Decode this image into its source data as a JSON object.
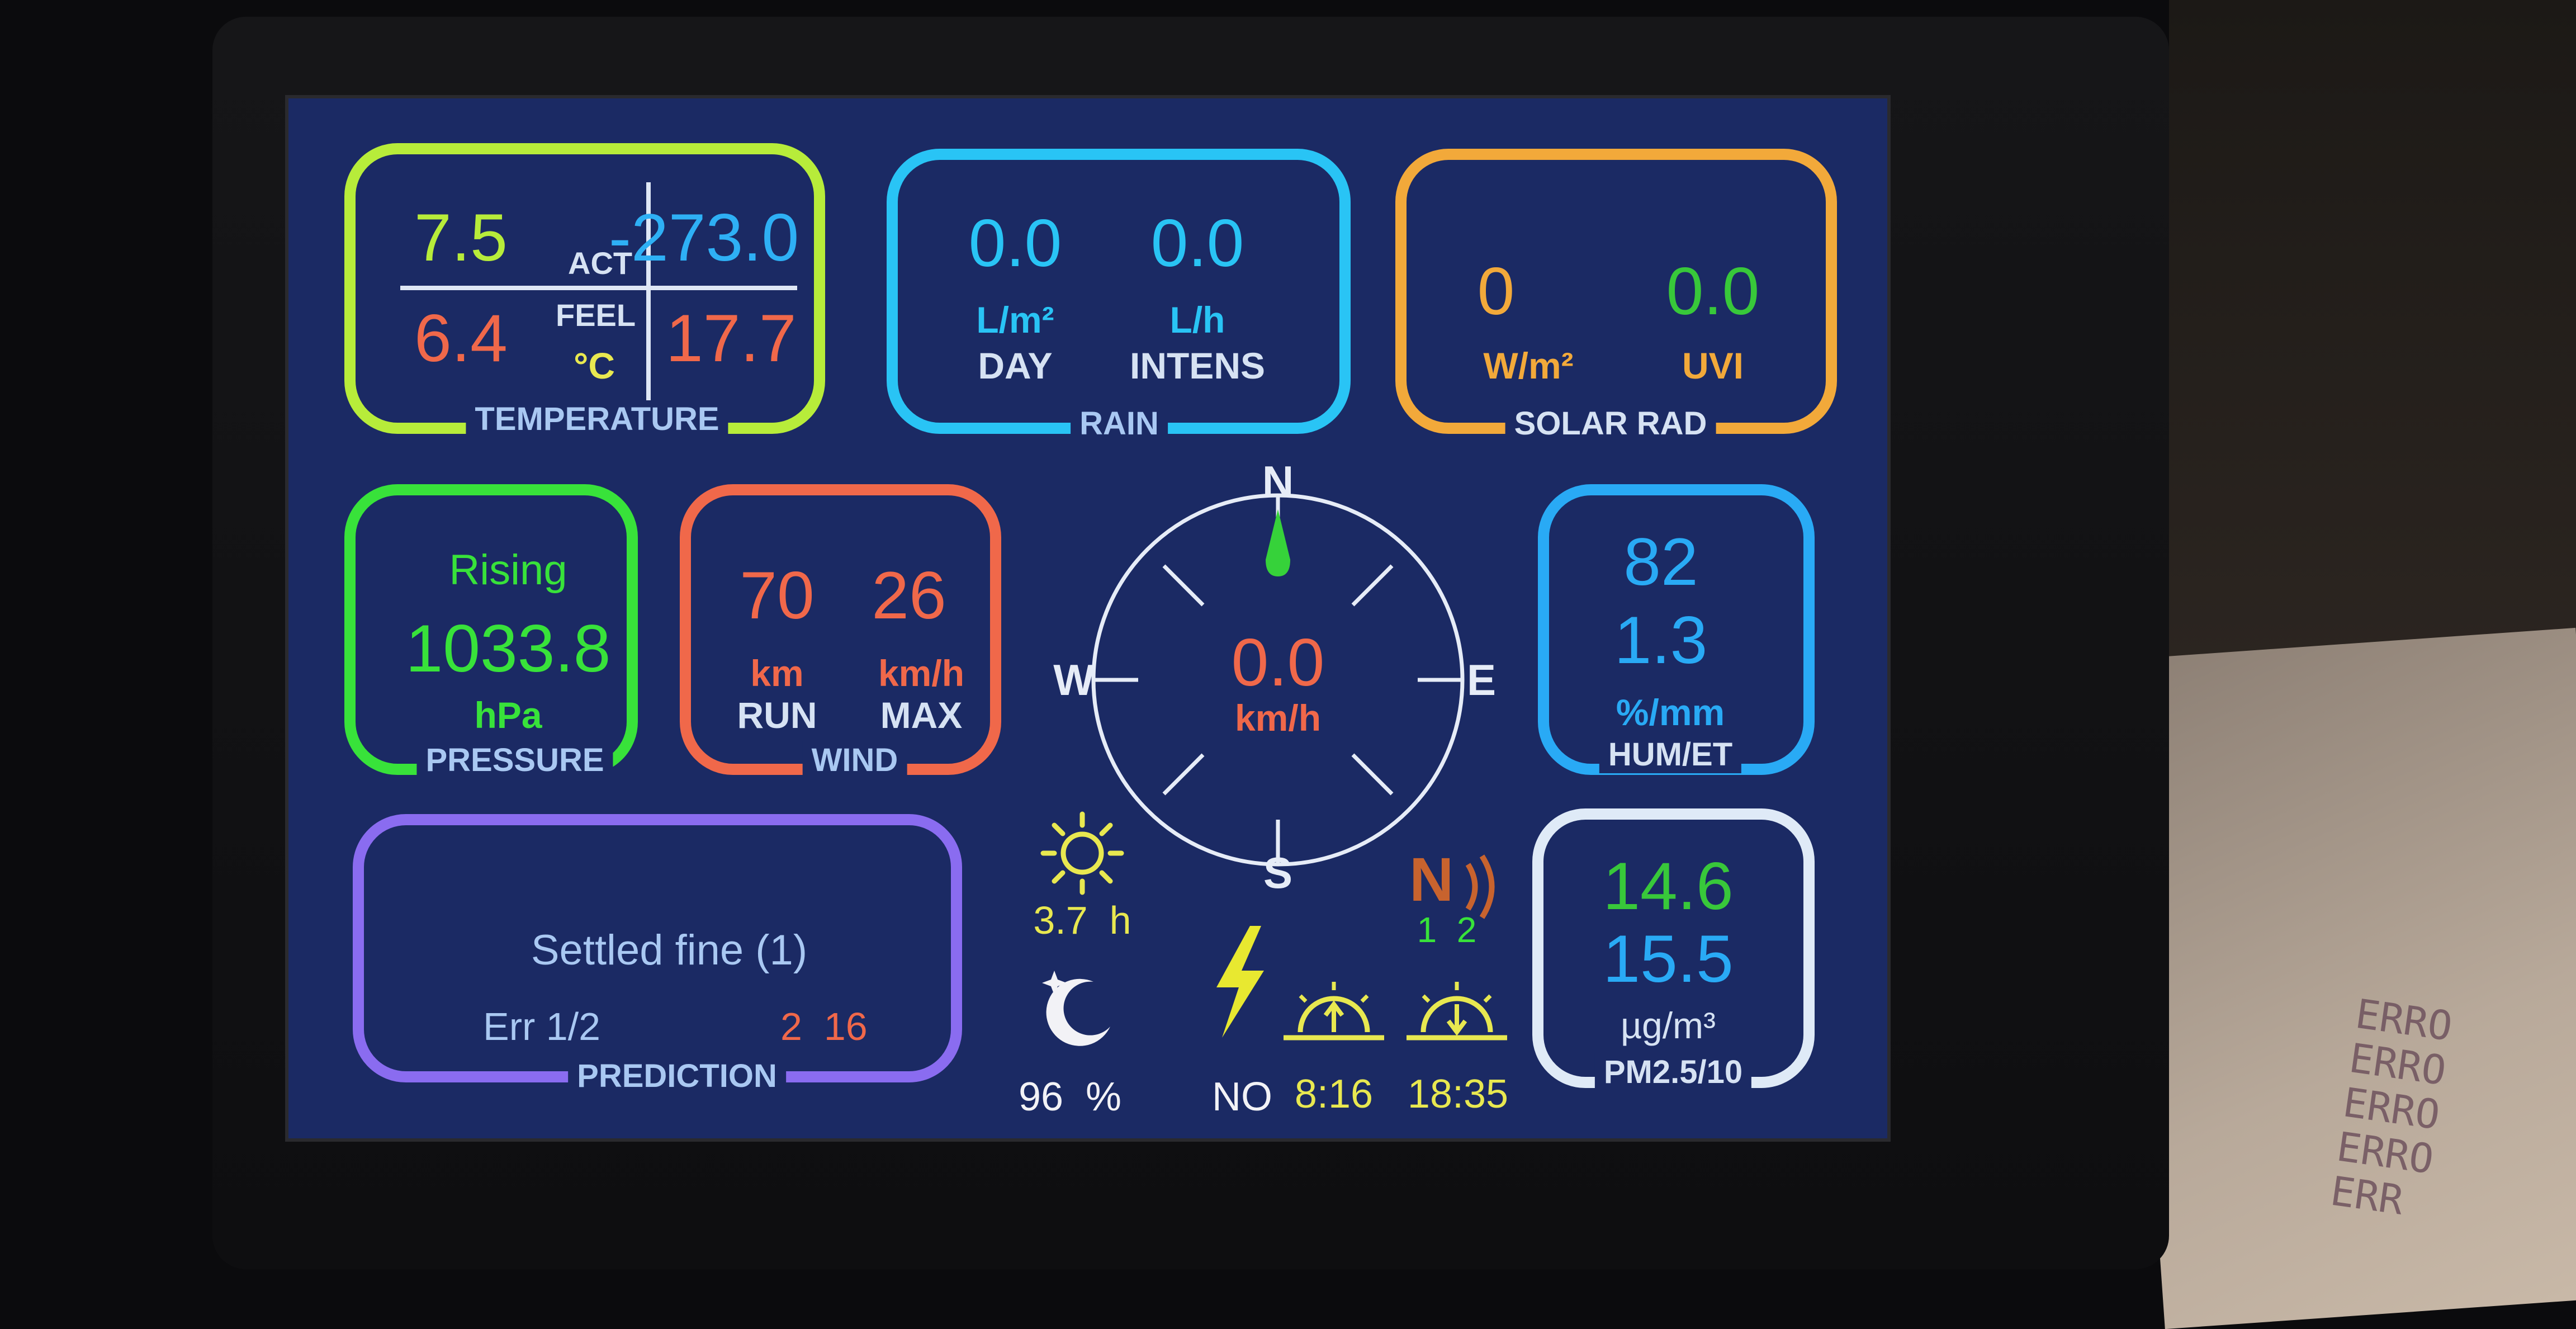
{
  "colors": {
    "screen_bg": "#1b2a64",
    "temperature": "#b7ec3a",
    "rain": "#29c4f5",
    "solar": "#f2a93a",
    "pressure": "#38e23a",
    "wind": "#f0684a",
    "humidity": "#29aaf5",
    "pm": "#dfeaf7",
    "prediction": "#8a6cf0"
  },
  "temperature": {
    "title": "TEMPERATURE",
    "actual": "7.5",
    "feel": "6.4",
    "min": "-273.0",
    "max": "17.7",
    "act_label": "ACT",
    "feel_label": "FEEL",
    "unit": "°C"
  },
  "rain": {
    "title": "RAIN",
    "day_value": "0.0",
    "day_unit": "L/m²",
    "day_label": "DAY",
    "intens_value": "0.0",
    "intens_unit": "L/h",
    "intens_label": "INTENS"
  },
  "solar": {
    "title": "SOLAR RAD",
    "rad_value": "0",
    "rad_unit": "W/m²",
    "uvi_value": "0.0",
    "uvi_label": "UVI"
  },
  "pressure": {
    "title": "PRESSURE",
    "trend": "Rising",
    "value": "1033.8",
    "unit": "hPa"
  },
  "wind": {
    "title": "WIND",
    "run_value": "70",
    "run_unit": "km",
    "run_label": "RUN",
    "max_value": "26",
    "max_unit": "km/h",
    "max_label": "MAX"
  },
  "compass": {
    "n": "N",
    "e": "E",
    "s": "S",
    "w": "W",
    "speed": "0.0",
    "unit": "km/h",
    "direction_deg": 0,
    "needle_icon": "wind-direction-needle"
  },
  "humidity": {
    "title": "HUM/ET",
    "humidity": "82",
    "et": "1.3",
    "unit": "%/mm"
  },
  "pm": {
    "title": "PM2.5/10",
    "pm25": "14.6",
    "pm10": "15.5",
    "unit": "µg/m³"
  },
  "prediction": {
    "title": "PREDICTION",
    "forecast": "Settled fine (1)",
    "err_label": "Err 1/2",
    "err_values": "2  16"
  },
  "status": {
    "sun_icon": "sun-icon",
    "sunshine_hours": "3.7  h",
    "moon_icon": "moon-icon",
    "moon_percent": "96  %",
    "lightning_icon": "lightning-icon",
    "lightning_text": "NO",
    "signal_icon": "signal-icon",
    "signal_values": "1  2",
    "sunrise_icon": "sunrise-icon",
    "sunrise": "8:16",
    "sunset_icon": "sunset-icon",
    "sunset": "18:35"
  },
  "background_note": [
    "ERRO",
    "ERRO",
    "ERRO",
    "ERRO",
    "ERR"
  ]
}
